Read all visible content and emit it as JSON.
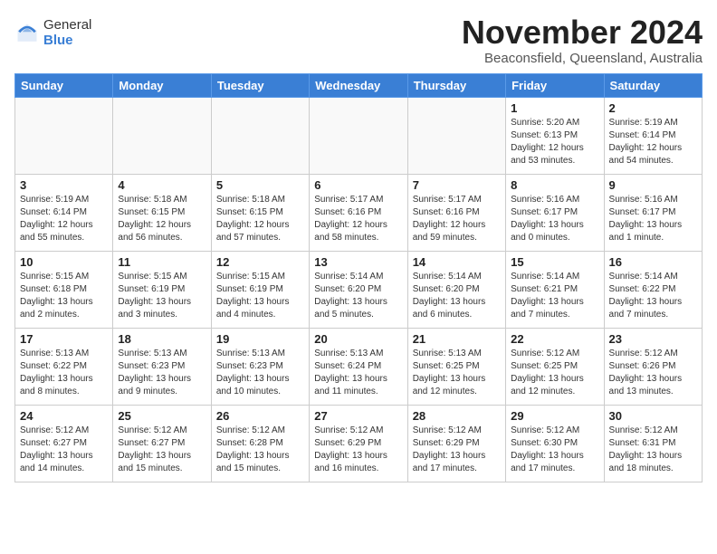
{
  "header": {
    "logo_general": "General",
    "logo_blue": "Blue",
    "title": "November 2024",
    "location": "Beaconsfield, Queensland, Australia"
  },
  "weekdays": [
    "Sunday",
    "Monday",
    "Tuesday",
    "Wednesday",
    "Thursday",
    "Friday",
    "Saturday"
  ],
  "weeks": [
    [
      {
        "day": "",
        "info": ""
      },
      {
        "day": "",
        "info": ""
      },
      {
        "day": "",
        "info": ""
      },
      {
        "day": "",
        "info": ""
      },
      {
        "day": "",
        "info": ""
      },
      {
        "day": "1",
        "info": "Sunrise: 5:20 AM\nSunset: 6:13 PM\nDaylight: 12 hours\nand 53 minutes."
      },
      {
        "day": "2",
        "info": "Sunrise: 5:19 AM\nSunset: 6:14 PM\nDaylight: 12 hours\nand 54 minutes."
      }
    ],
    [
      {
        "day": "3",
        "info": "Sunrise: 5:19 AM\nSunset: 6:14 PM\nDaylight: 12 hours\nand 55 minutes."
      },
      {
        "day": "4",
        "info": "Sunrise: 5:18 AM\nSunset: 6:15 PM\nDaylight: 12 hours\nand 56 minutes."
      },
      {
        "day": "5",
        "info": "Sunrise: 5:18 AM\nSunset: 6:15 PM\nDaylight: 12 hours\nand 57 minutes."
      },
      {
        "day": "6",
        "info": "Sunrise: 5:17 AM\nSunset: 6:16 PM\nDaylight: 12 hours\nand 58 minutes."
      },
      {
        "day": "7",
        "info": "Sunrise: 5:17 AM\nSunset: 6:16 PM\nDaylight: 12 hours\nand 59 minutes."
      },
      {
        "day": "8",
        "info": "Sunrise: 5:16 AM\nSunset: 6:17 PM\nDaylight: 13 hours\nand 0 minutes."
      },
      {
        "day": "9",
        "info": "Sunrise: 5:16 AM\nSunset: 6:17 PM\nDaylight: 13 hours\nand 1 minute."
      }
    ],
    [
      {
        "day": "10",
        "info": "Sunrise: 5:15 AM\nSunset: 6:18 PM\nDaylight: 13 hours\nand 2 minutes."
      },
      {
        "day": "11",
        "info": "Sunrise: 5:15 AM\nSunset: 6:19 PM\nDaylight: 13 hours\nand 3 minutes."
      },
      {
        "day": "12",
        "info": "Sunrise: 5:15 AM\nSunset: 6:19 PM\nDaylight: 13 hours\nand 4 minutes."
      },
      {
        "day": "13",
        "info": "Sunrise: 5:14 AM\nSunset: 6:20 PM\nDaylight: 13 hours\nand 5 minutes."
      },
      {
        "day": "14",
        "info": "Sunrise: 5:14 AM\nSunset: 6:20 PM\nDaylight: 13 hours\nand 6 minutes."
      },
      {
        "day": "15",
        "info": "Sunrise: 5:14 AM\nSunset: 6:21 PM\nDaylight: 13 hours\nand 7 minutes."
      },
      {
        "day": "16",
        "info": "Sunrise: 5:14 AM\nSunset: 6:22 PM\nDaylight: 13 hours\nand 7 minutes."
      }
    ],
    [
      {
        "day": "17",
        "info": "Sunrise: 5:13 AM\nSunset: 6:22 PM\nDaylight: 13 hours\nand 8 minutes."
      },
      {
        "day": "18",
        "info": "Sunrise: 5:13 AM\nSunset: 6:23 PM\nDaylight: 13 hours\nand 9 minutes."
      },
      {
        "day": "19",
        "info": "Sunrise: 5:13 AM\nSunset: 6:23 PM\nDaylight: 13 hours\nand 10 minutes."
      },
      {
        "day": "20",
        "info": "Sunrise: 5:13 AM\nSunset: 6:24 PM\nDaylight: 13 hours\nand 11 minutes."
      },
      {
        "day": "21",
        "info": "Sunrise: 5:13 AM\nSunset: 6:25 PM\nDaylight: 13 hours\nand 12 minutes."
      },
      {
        "day": "22",
        "info": "Sunrise: 5:12 AM\nSunset: 6:25 PM\nDaylight: 13 hours\nand 12 minutes."
      },
      {
        "day": "23",
        "info": "Sunrise: 5:12 AM\nSunset: 6:26 PM\nDaylight: 13 hours\nand 13 minutes."
      }
    ],
    [
      {
        "day": "24",
        "info": "Sunrise: 5:12 AM\nSunset: 6:27 PM\nDaylight: 13 hours\nand 14 minutes."
      },
      {
        "day": "25",
        "info": "Sunrise: 5:12 AM\nSunset: 6:27 PM\nDaylight: 13 hours\nand 15 minutes."
      },
      {
        "day": "26",
        "info": "Sunrise: 5:12 AM\nSunset: 6:28 PM\nDaylight: 13 hours\nand 15 minutes."
      },
      {
        "day": "27",
        "info": "Sunrise: 5:12 AM\nSunset: 6:29 PM\nDaylight: 13 hours\nand 16 minutes."
      },
      {
        "day": "28",
        "info": "Sunrise: 5:12 AM\nSunset: 6:29 PM\nDaylight: 13 hours\nand 17 minutes."
      },
      {
        "day": "29",
        "info": "Sunrise: 5:12 AM\nSunset: 6:30 PM\nDaylight: 13 hours\nand 17 minutes."
      },
      {
        "day": "30",
        "info": "Sunrise: 5:12 AM\nSunset: 6:31 PM\nDaylight: 13 hours\nand 18 minutes."
      }
    ]
  ]
}
